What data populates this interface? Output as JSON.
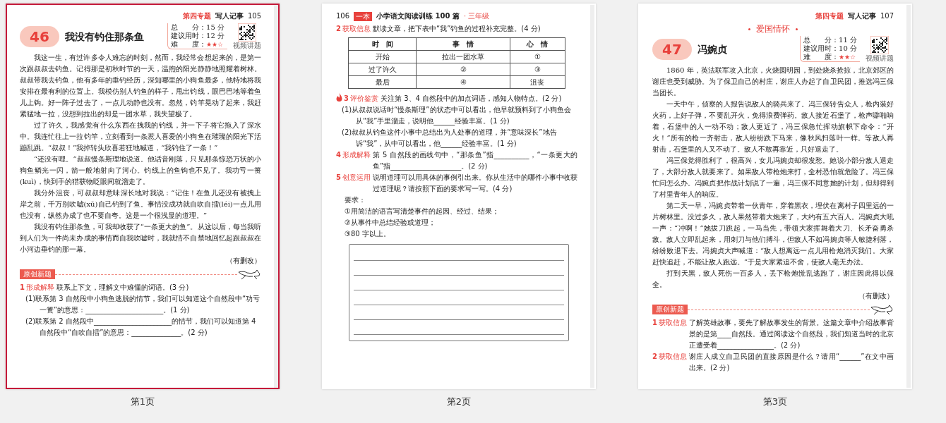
{
  "pages": [
    {
      "label": "第1页",
      "selected": true,
      "header": {
        "kind": "topic",
        "topic": "第四专题",
        "unit": "写人记事",
        "number": "105"
      },
      "blocks": [
        {
          "kind": "title",
          "number": "46",
          "title": "我没有钓住那条鱼",
          "info": [
            "总　　分：15 分",
            "建议用时：12 分",
            "难　　度："
          ],
          "stars": 2,
          "qr_caption": "视频讲题"
        },
        {
          "kind": "para",
          "text": "我这一生，有过许多令人难忘的时刻，然而，我经常会想起来的，是第一次跟叔叔去钓鱼。记得那是初秋时节的一天，温煦的阳光静静地照耀着树林。叔叔带我去钓鱼，他有多年的垂钓经历，深知哪里的小狗鱼最多，他特地将我安排在最有利的位置上。我模仿别人钓鱼的样子，甩出钓线，眼巴巴地等着鱼儿上钩。好一阵子过去了，一点儿动静也没有。忽然，钓竿晃动了起来，我赶紧猛地一拉，没想到拉出的却是一团水草，我失望极了。"
        },
        {
          "kind": "para",
          "text": "过了许久，我感觉有什么东西在拽我的钓线，并一下子将它拖入了深水中。我连忙往上一拉钓竿，立刻看到一条惹人喜爱的小狗鱼在璀璨的阳光下活蹦乱跳。“叔叔！”我掉转头欣喜若狂地喊道，“我钓住了一条！”"
        },
        {
          "kind": "para",
          "text": "“还没有哩。”叔叔慢条斯理地说道。他话音刚落，只见那条惊恐万状的小狗鱼鳞光一闪，箭一般地射向了河心。钓线上的鱼钩也不见了。我功亏一篑(kuì)，快到手的猎获物眨眼间就溜走了。"
        },
        {
          "kind": "para",
          "text": "我分外沮丧，可叔叔却意味深长地对我说：“记住！在鱼儿还没有被拽上岸之前，千万别吹嘘(xū)自己钓到了鱼。事情没成功就自吹自擂(léi)一点儿用也没有，纵然办成了也不要自夸。这是一个很浅显的道理。”"
        },
        {
          "kind": "para",
          "text": "我没有钓住那条鱼，可我却收获了“一条更大的鱼”。从这以后，每当我听到人们为一件尚未办成的事情而自我吹嘘时，我就情不自禁地回忆起跟叔叔在小河边垂钓的那一幕。"
        },
        {
          "kind": "source",
          "text": "（有删改）"
        },
        {
          "kind": "section",
          "text": "原创新题"
        },
        {
          "kind": "question",
          "number": "1",
          "tag": "形成解释",
          "text": "联系上下文，理解文中难懂的词语。(3 分)",
          "hot": false
        },
        {
          "kind": "sub",
          "text": "(1)联系第 3 自然段中小狗鱼逃脱的情节，我们可以知道这个自然段中“功亏一篑”的意思：______________________。(1 分)"
        },
        {
          "kind": "sub",
          "text": "(2)联系第 2 自然段中______________________的情节，我们可以知道第 4 自然段中“自吹自擂”的意思：______________。(2 分)"
        }
      ]
    },
    {
      "label": "第2页",
      "selected": false,
      "header": {
        "kind": "book",
        "number": "106",
        "brand": "一本",
        "book": "小学语文阅读训练 100 篇",
        "grade": "· 三年级"
      },
      "blocks": [
        {
          "kind": "question",
          "number": "2",
          "tag": "获取信息",
          "text": "默读文章，把下表中“我”钓鱼的过程补充完整。(4 分)",
          "hot": false
        },
        {
          "kind": "table",
          "columns": [
            "时　间",
            "事　情",
            "心　情"
          ],
          "rows": [
            [
              "开始",
              "拉出一团水草",
              "①"
            ],
            [
              "过了许久",
              "②",
              "③"
            ],
            [
              "最后",
              "④",
              "沮丧"
            ]
          ]
        },
        {
          "kind": "question",
          "number": "3",
          "tag": "评价鉴赏",
          "text": "关注第 3、4 自然段中的加点词语，感知人物特点。(2 分)",
          "hot": true
        },
        {
          "kind": "sub",
          "text": "(1)从叔叔说话时“慢条斯理”的状态中可以看出，他早就预料到了小狗鱼会从“我”手里溜走，说明他______经验丰富。(1 分)"
        },
        {
          "kind": "sub",
          "text": "(2)叔叔从钓鱼这件小事中总结出为人处事的道理，并“意味深长”地告诉“我”，从中可以看出，他______经验丰富。(1 分)"
        },
        {
          "kind": "question",
          "number": "4",
          "tag": "形成解释",
          "text": "第 5 自然段的画线句中，“那条鱼”指__________，“一条更大的鱼”指____________________。(2 分)",
          "hot": false
        },
        {
          "kind": "question",
          "number": "5",
          "tag": "创意运用",
          "text": "说明道理可以用具体的事例引出来。你从生活中的哪件小事中收获过道理呢？请按照下面的要求写一写。(4 分)",
          "hot": false
        },
        {
          "kind": "line",
          "text": "要求："
        },
        {
          "kind": "line",
          "text": "①用简洁的语言写清楚事件的起因、经过、结果；"
        },
        {
          "kind": "line",
          "text": "②从事件中总结经验或道理；"
        },
        {
          "kind": "line",
          "text": "③80 字以上。"
        },
        {
          "kind": "writing"
        }
      ]
    },
    {
      "label": "第3页",
      "selected": false,
      "header": {
        "kind": "topic",
        "topic": "第四专题",
        "unit": "写人记事",
        "number": "107"
      },
      "blocks": [
        {
          "kind": "theme",
          "text": "爱国情怀"
        },
        {
          "kind": "title",
          "number": "47",
          "title": "冯婉贞",
          "info": [
            "总　　分：11 分",
            "建议用时：10 分",
            "难　　度："
          ],
          "stars": 2,
          "qr_caption": "视频讲题"
        },
        {
          "kind": "para",
          "text": "1860 年，英法联军攻入北京，火烧圆明园，到处烧杀抢掠，北京郊区的谢庄也受到威胁。为了保卫自己的村庄，谢庄人办起了自卫民团，推选冯三保当团长。"
        },
        {
          "kind": "para",
          "text": "一天中午，侦察的人报告说敌人的骑兵来了。冯三保转告众人，枪内装好火药，上好子弹，不要乱开火，免得浪费弹药。敌人接近石堡了，枪声噼啪响着，石堡中的人一动不动；敌人更近了，冯三保急忙挥动旗帜下命令：“开火！”所有的枪一齐射击，敌人纷纷跌下马来，像秋风扫落叶一样。等敌人再射击，石堡里的人又不动了。敌人不敢再靠近，只好退走了。"
        },
        {
          "kind": "para",
          "text": "冯三保觉得胜利了，很高兴，女儿冯婉贞却很发愁。她说小部分敌人退走了，大部分敌人就要来了。如果敌人带枪炮来打，全村恐怕就危险了。冯三保忙问怎么办。冯婉贞把作战计划说了一遍，冯三保不同意她的计划，但却得到了村里青年人的响应。"
        },
        {
          "kind": "para",
          "text": "第二天一早，冯婉贞带着一伙青年，穿着黑衣，埋伏在离村子四里远的一片树林里。没过多久，敌人果然带着大炮来了，大约有五六百人。冯婉贞大吼一声：“冲啊！”她拔刀跳起，一马当先，带领大家挥舞着大刀、长矛奋勇杀敌。敌人立即乱起来，用刺刀与他们搏斗，但敌人不如冯婉贞等人敏捷利落，纷纷败退下去。冯婉贞大声喊道：“敌人想离远一点儿用枪炮消灭我们。大家赶快追赶，不能让敌人跑远。”于是大家紧追不舍，使敌人毫无办法。"
        },
        {
          "kind": "para",
          "text": "打到天黑，敌人死伤一百多人，丢下枪炮慌乱逃跑了，谢庄因此得以保全。"
        },
        {
          "kind": "source",
          "text": "（有删改）"
        },
        {
          "kind": "section",
          "text": "原创新题"
        },
        {
          "kind": "question",
          "number": "1",
          "tag": "获取信息",
          "text": "了解英雄故事，要先了解故事发生的背景。这篇文章中介绍故事背景的是第____自然段。通过阅读这个自然段，我们知道当时的北京正遭受着________________。(2 分)",
          "hot": false
        },
        {
          "kind": "question",
          "number": "2",
          "tag": "获取信息",
          "text": "谢庄人成立自卫民团的直接原因是什么？请用“______”在文中画出来。(2 分)",
          "hot": false
        }
      ]
    }
  ]
}
